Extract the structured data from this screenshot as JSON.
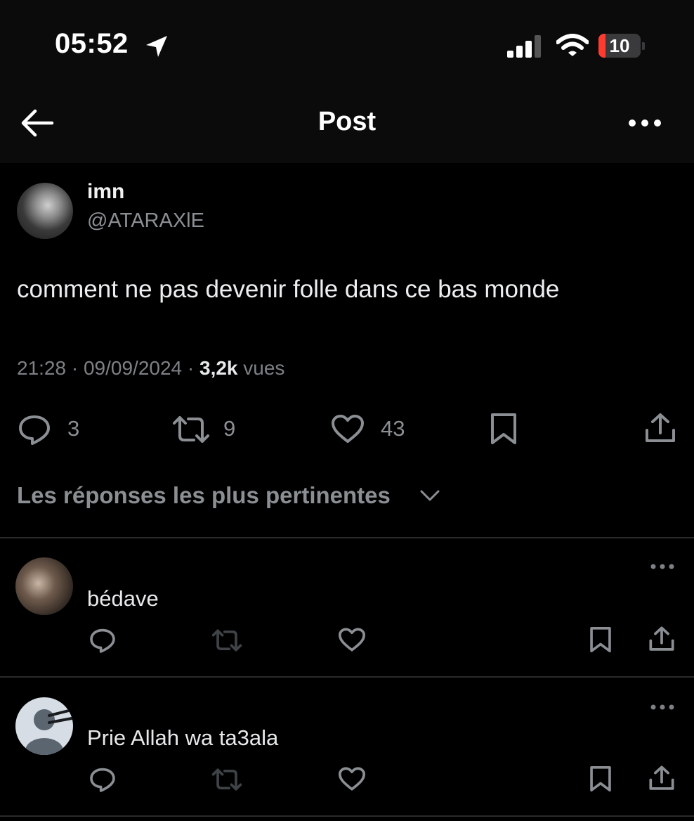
{
  "status_bar": {
    "time": "05:52",
    "battery_level": "10",
    "battery_color": "#ff3b30"
  },
  "header": {
    "title": "Post"
  },
  "post": {
    "author_name": "imn",
    "author_handle": "@ATARAXlE",
    "text": "comment ne pas devenir folle dans ce bas monde",
    "time": "21:28",
    "date": "09/09/2024",
    "views_count": "3,2k",
    "views_label": "vues",
    "replies": "3",
    "reposts": "9",
    "likes": "43"
  },
  "replies_sort": {
    "label": "Les réponses les plus pertinentes"
  },
  "replies": [
    {
      "text": "bédave"
    },
    {
      "text": "Prie Allah wa ta3ala"
    }
  ],
  "icons": {
    "status": [
      "location-arrow-icon",
      "signal-icon",
      "wifi-icon",
      "battery-icon"
    ],
    "header": [
      "back-arrow-icon",
      "more-icon"
    ],
    "actions": [
      "reply-icon",
      "repost-icon",
      "like-icon",
      "bookmark-icon",
      "share-icon"
    ]
  },
  "colors": {
    "background": "#000000",
    "muted_text": "#8b8f94"
  }
}
